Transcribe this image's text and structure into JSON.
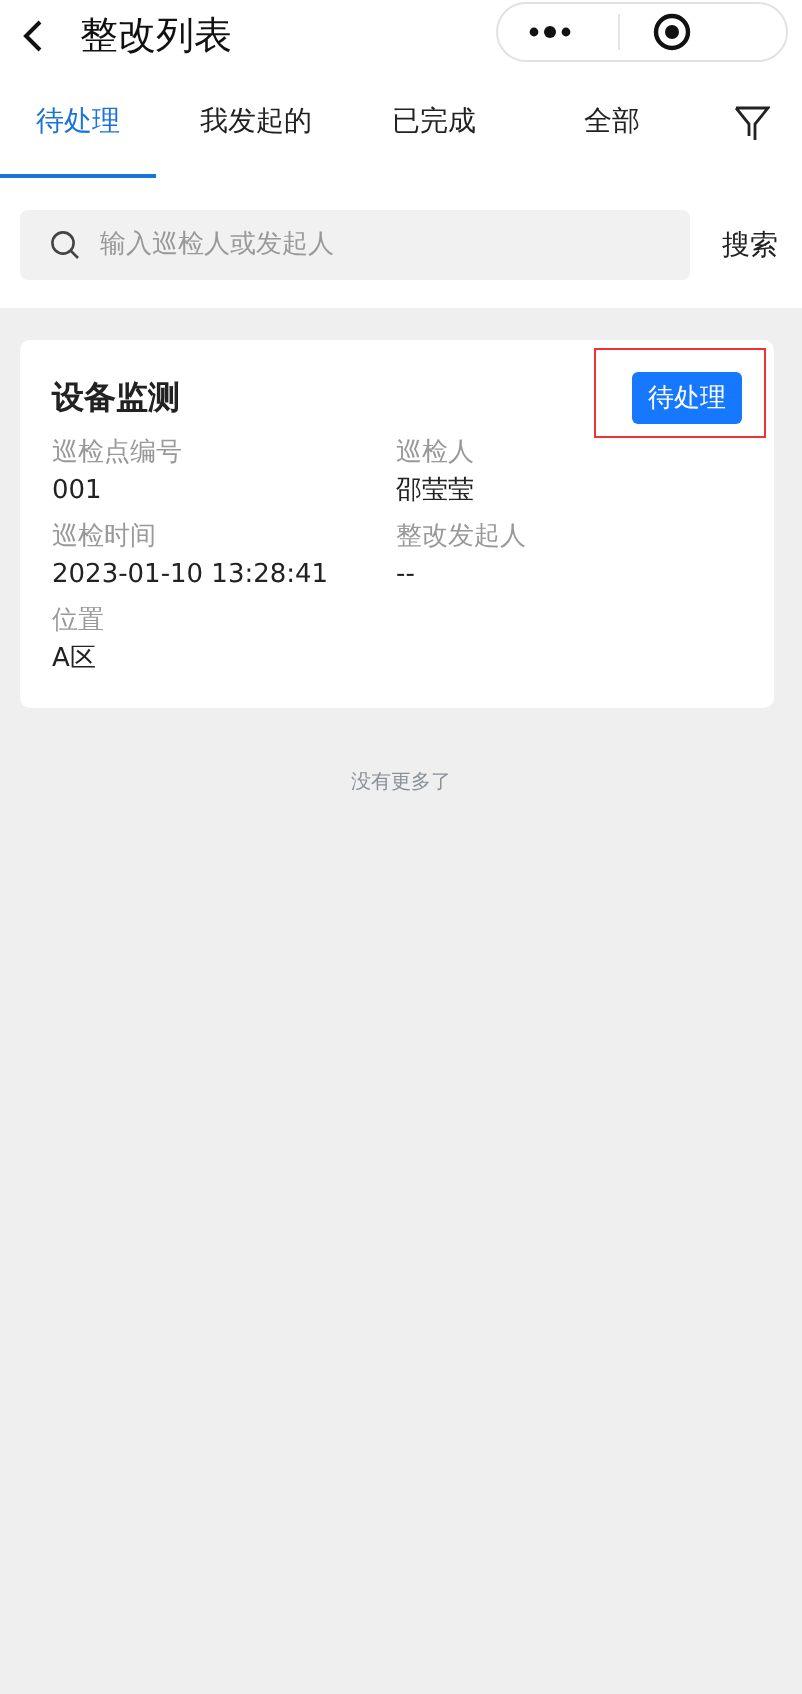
{
  "header": {
    "title": "整改列表"
  },
  "tabs": [
    {
      "label": "待处理",
      "selected": true
    },
    {
      "label": "我发起的",
      "selected": false
    },
    {
      "label": "已完成",
      "selected": false
    },
    {
      "label": "全部",
      "selected": false
    }
  ],
  "search": {
    "placeholder": "输入巡检人或发起人",
    "button": "搜索"
  },
  "cards": [
    {
      "title": "设备监测",
      "status": "待处理",
      "highlighted": true,
      "fields": [
        {
          "label": "巡检点编号",
          "value": "001"
        },
        {
          "label": "巡检人",
          "value": "邵莹莹"
        },
        {
          "label": "巡检时间",
          "value": "2023-01-10 13:28:41"
        },
        {
          "label": "整改发起人",
          "value": "--"
        },
        {
          "label": "位置",
          "value": "A区"
        }
      ]
    }
  ],
  "footer": "没有更多了"
}
